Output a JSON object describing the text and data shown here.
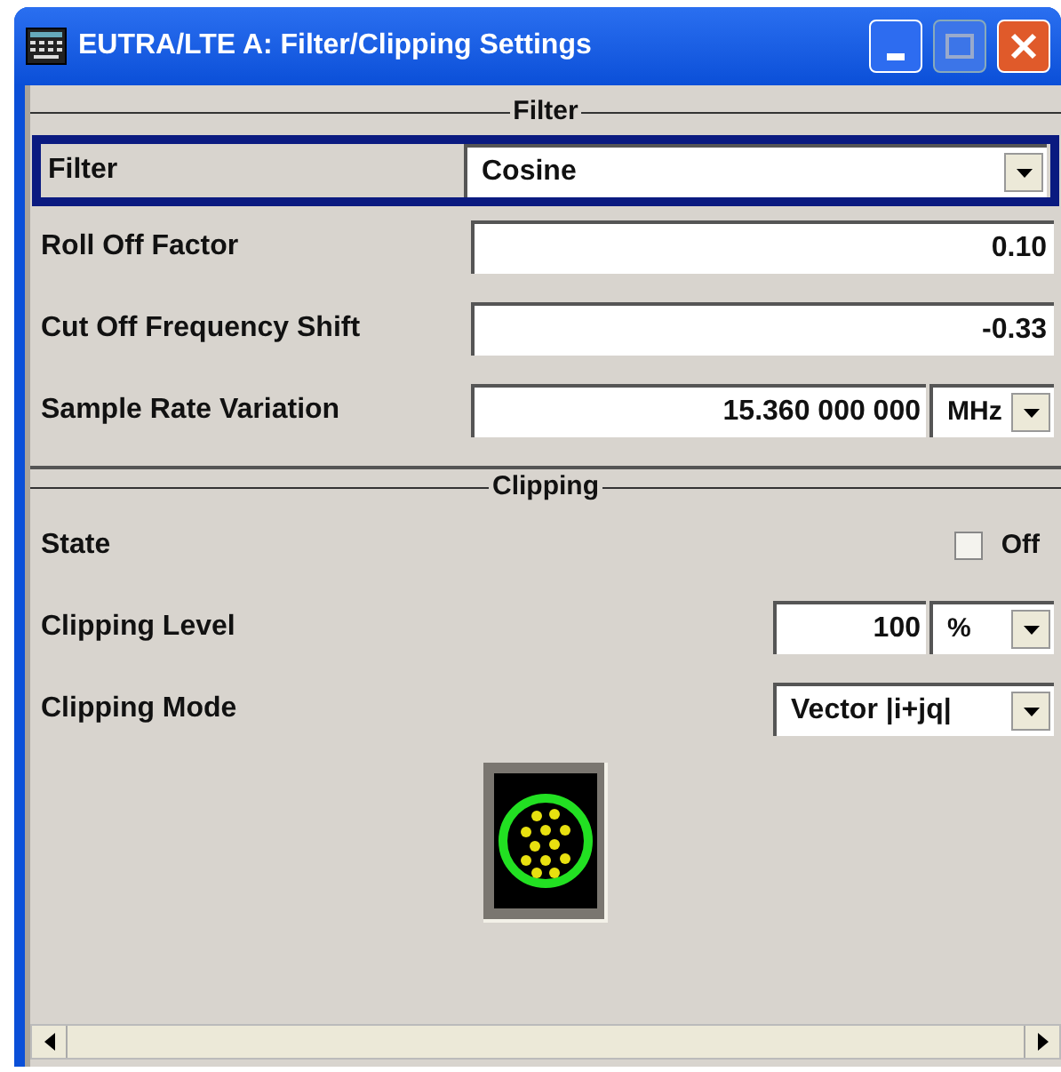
{
  "window": {
    "title": "EUTRA/LTE A: Filter/Clipping Settings"
  },
  "sections": [
    {
      "heading": "Filter",
      "rows": [
        {
          "kind": "dropdown",
          "label": "Filter",
          "value": "Cosine",
          "focused": true
        },
        {
          "kind": "number",
          "label": "Roll Off Factor",
          "value": "0.10"
        },
        {
          "kind": "number",
          "label": "Cut Off Frequency Shift",
          "value": "-0.33"
        },
        {
          "kind": "number_unit",
          "label": "Sample Rate Variation",
          "value": "15.360 000 000",
          "unit": "MHz"
        }
      ]
    },
    {
      "heading": "Clipping",
      "rows": [
        {
          "kind": "checkbox",
          "label": "State",
          "checked": false,
          "value": "Off"
        },
        {
          "kind": "number_unit",
          "label": "Clipping Level",
          "value": "100",
          "unit": "%",
          "short": true
        },
        {
          "kind": "dropdown",
          "label": "Clipping Mode",
          "value": "Vector |i+jq|",
          "short": true
        },
        {
          "kind": "constellation"
        }
      ]
    }
  ]
}
